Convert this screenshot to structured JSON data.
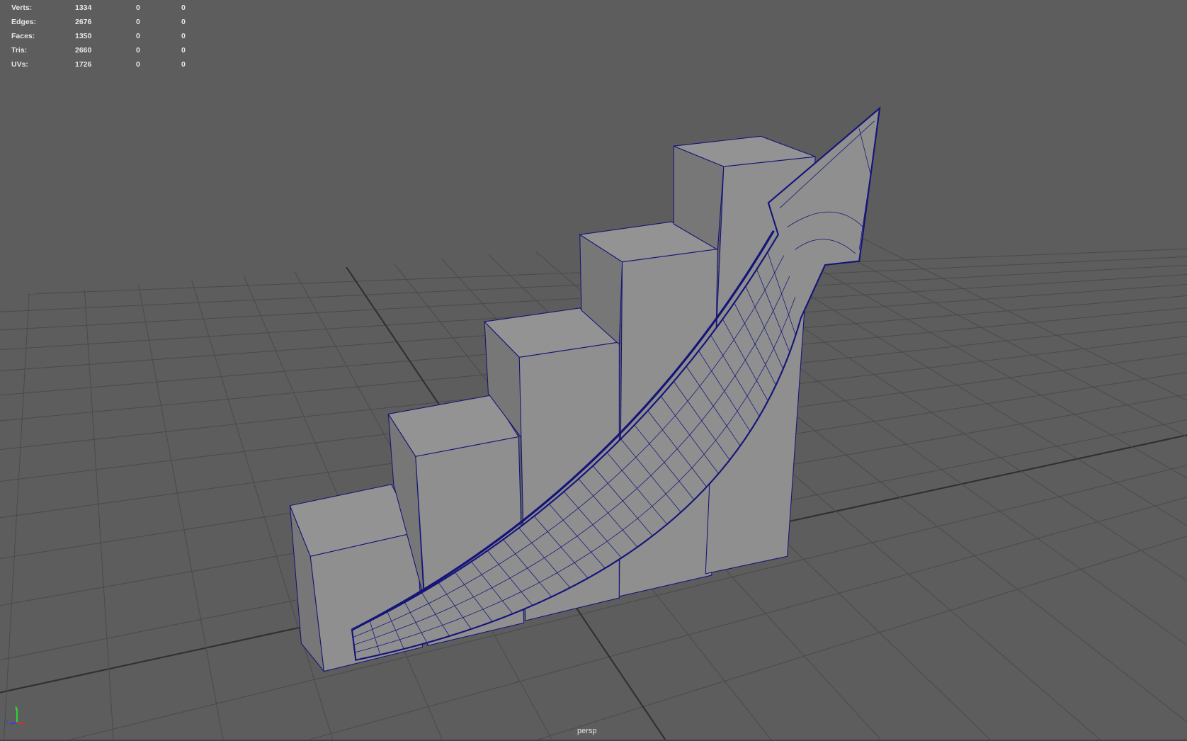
{
  "stats": {
    "rows": [
      {
        "label": "Verts:",
        "total": "1334",
        "selected": "0",
        "other": "0"
      },
      {
        "label": "Edges:",
        "total": "2676",
        "selected": "0",
        "other": "0"
      },
      {
        "label": "Faces:",
        "total": "1350",
        "selected": "0",
        "other": "0"
      },
      {
        "label": "Tris:",
        "total": "2660",
        "selected": "0",
        "other": "0"
      },
      {
        "label": "UVs:",
        "total": "1726",
        "selected": "0",
        "other": "0"
      }
    ]
  },
  "camera_label": "persp",
  "axis_gizmo": {
    "x": "x",
    "y": "y",
    "z": "z"
  },
  "colors": {
    "background": "#5d5d5d",
    "grid": "#4b4b4b",
    "grid_axis": "#303030",
    "mesh_fill": "#8f8f8f",
    "mesh_side": "#777777",
    "wire": "#14147a"
  }
}
